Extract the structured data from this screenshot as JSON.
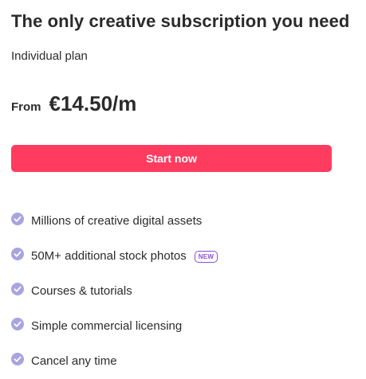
{
  "plan": {
    "title": "The only creative subscription you need",
    "subtitle": "Individual plan",
    "price_prefix": "From",
    "price": "€14.50/m",
    "cta_label": "Start now"
  },
  "features": [
    {
      "label": "Millions of creative digital assets",
      "icon": "check-circle-icon"
    },
    {
      "label": "50M+ additional stock photos",
      "icon": "check-circle-icon",
      "badge": "NEW"
    },
    {
      "label": "Courses & tutorials",
      "icon": "check-circle-icon"
    },
    {
      "label": "Simple commercial licensing",
      "icon": "check-circle-icon"
    },
    {
      "label": "Cancel any time",
      "icon": "check-circle-icon"
    }
  ],
  "colors": {
    "accent": "#ff3c5f",
    "check": "#a9a4e0",
    "badge": "#8a4fd8",
    "text": "#2b2b2b"
  }
}
